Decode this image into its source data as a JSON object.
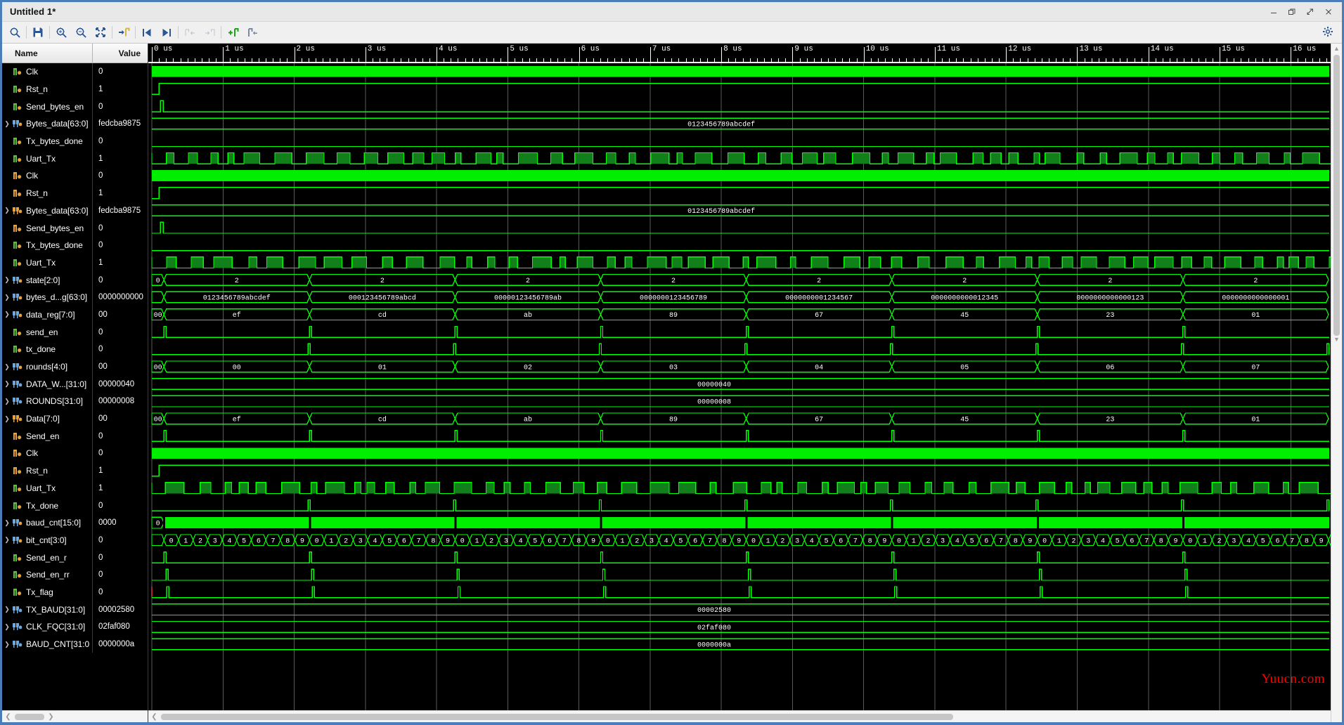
{
  "window": {
    "title": "Untitled 1*",
    "controls": [
      "minimize",
      "restore",
      "maximize",
      "close"
    ]
  },
  "toolbar": {
    "buttons": [
      {
        "name": "search-icon",
        "label": "Search",
        "enabled": true
      },
      {
        "name": "save-icon",
        "label": "Save",
        "enabled": true
      },
      {
        "name": "zoom-in-icon",
        "label": "Zoom In",
        "enabled": true
      },
      {
        "name": "zoom-out-icon",
        "label": "Zoom Out",
        "enabled": true
      },
      {
        "name": "zoom-fit-icon",
        "label": "Zoom Fit",
        "enabled": true
      },
      {
        "name": "goto-marker-icon",
        "label": "Go To Marker",
        "enabled": true
      },
      {
        "name": "previous-transition-icon",
        "label": "Previous Transition",
        "enabled": true
      },
      {
        "name": "next-transition-icon",
        "label": "Next Transition",
        "enabled": true
      },
      {
        "name": "previous-marker-icon",
        "label": "Previous Marker",
        "enabled": false
      },
      {
        "name": "next-marker-icon",
        "label": "Next Marker",
        "enabled": false
      },
      {
        "name": "add-marker-icon",
        "label": "Add Marker",
        "enabled": true
      },
      {
        "name": "delete-marker-icon",
        "label": "Delete Marker",
        "enabled": true
      }
    ],
    "settings_label": "Settings"
  },
  "columns": {
    "name": "Name",
    "value": "Value"
  },
  "signals": [
    {
      "name": "Clk",
      "value": "0",
      "icon": "clock-green",
      "expandable": false
    },
    {
      "name": "Rst_n",
      "value": "1",
      "icon": "wire-green",
      "expandable": false
    },
    {
      "name": "Send_bytes_en",
      "value": "0",
      "icon": "wire-green",
      "expandable": false
    },
    {
      "name": "Bytes_data[63:0]",
      "value": "fedcba9875",
      "icon": "bus-orange",
      "expandable": true
    },
    {
      "name": "Tx_bytes_done",
      "value": "0",
      "icon": "wire-green",
      "expandable": false
    },
    {
      "name": "Uart_Tx",
      "value": "1",
      "icon": "wire-green",
      "expandable": false
    },
    {
      "name": "Clk",
      "value": "0",
      "icon": "clock-orange",
      "expandable": false
    },
    {
      "name": "Rst_n",
      "value": "1",
      "icon": "wire-orange",
      "expandable": false
    },
    {
      "name": "Bytes_data[63:0]",
      "value": "fedcba9875",
      "icon": "bus-orange2",
      "expandable": true
    },
    {
      "name": "Send_bytes_en",
      "value": "0",
      "icon": "wire-orange",
      "expandable": false
    },
    {
      "name": "Tx_bytes_done",
      "value": "0",
      "icon": "wire-green2",
      "expandable": false
    },
    {
      "name": "Uart_Tx",
      "value": "1",
      "icon": "wire-green2",
      "expandable": false
    },
    {
      "name": "state[2:0]",
      "value": "0",
      "icon": "bus-orange",
      "expandable": true
    },
    {
      "name": "bytes_d...g[63:0]",
      "value": "0000000000",
      "icon": "bus-orange",
      "expandable": true
    },
    {
      "name": "data_reg[7:0]",
      "value": "00",
      "icon": "bus-orange",
      "expandable": true
    },
    {
      "name": "send_en",
      "value": "0",
      "icon": "wire-green",
      "expandable": false
    },
    {
      "name": "tx_done",
      "value": "0",
      "icon": "wire-green",
      "expandable": false
    },
    {
      "name": "rounds[4:0]",
      "value": "00",
      "icon": "bus-orange",
      "expandable": true
    },
    {
      "name": "DATA_W...[31:0]",
      "value": "00000040",
      "icon": "bus-blue",
      "expandable": true
    },
    {
      "name": "ROUNDS[31:0]",
      "value": "00000008",
      "icon": "bus-blue",
      "expandable": true
    },
    {
      "name": "Data[7:0]",
      "value": "00",
      "icon": "bus-orange2",
      "expandable": true
    },
    {
      "name": "Send_en",
      "value": "0",
      "icon": "wire-orange",
      "expandable": false
    },
    {
      "name": "Clk",
      "value": "0",
      "icon": "clock-orange",
      "expandable": false
    },
    {
      "name": "Rst_n",
      "value": "1",
      "icon": "wire-orange",
      "expandable": false
    },
    {
      "name": "Uart_Tx",
      "value": "1",
      "icon": "wire-green2",
      "expandable": false
    },
    {
      "name": "Tx_done",
      "value": "0",
      "icon": "wire-green2",
      "expandable": false
    },
    {
      "name": "baud_cnt[15:0]",
      "value": "0000",
      "icon": "bus-orange",
      "expandable": true
    },
    {
      "name": "bit_cnt[3:0]",
      "value": "0",
      "icon": "bus-orange",
      "expandable": true
    },
    {
      "name": "Send_en_r",
      "value": "0",
      "icon": "wire-green",
      "expandable": false
    },
    {
      "name": "Send_en_rr",
      "value": "0",
      "icon": "wire-green",
      "expandable": false
    },
    {
      "name": "Tx_flag",
      "value": "0",
      "icon": "wire-green",
      "expandable": false
    },
    {
      "name": "TX_BAUD[31:0]",
      "value": "00002580",
      "icon": "bus-blue",
      "expandable": true
    },
    {
      "name": "CLK_FQC[31:0]",
      "value": "02faf080",
      "icon": "bus-blue",
      "expandable": true
    },
    {
      "name": "BAUD_CNT[31:0",
      "value": "0000000a",
      "icon": "bus-blue",
      "expandable": true
    }
  ],
  "timeline": {
    "unit": "us",
    "labels": [
      "0 us",
      "1 us",
      "2 us",
      "3 us",
      "4 us",
      "5 us",
      "6 us",
      "7 us",
      "8 us",
      "9 us",
      "10 us",
      "11 us",
      "12 us",
      "13 us",
      "14 us",
      "15 us",
      "16 us"
    ],
    "start": 0,
    "end": 16.55,
    "minor_per_major": 10
  },
  "waveforms": {
    "constant_labels": [
      {
        "row": 3,
        "text": "0123456789abcdef",
        "x_us": 8.0
      },
      {
        "row": 8,
        "text": "0123456789abcdef",
        "x_us": 8.0
      },
      {
        "row": 18,
        "text": "00000040",
        "x_us": 7.9
      },
      {
        "row": 19,
        "text": "00000008",
        "x_us": 7.9
      },
      {
        "row": 31,
        "text": "00002580",
        "x_us": 7.9
      },
      {
        "row": 32,
        "text": "02faf080",
        "x_us": 7.9
      },
      {
        "row": 33,
        "text": "0000000a",
        "x_us": 7.9
      }
    ],
    "state_row": {
      "row": 12,
      "initial": "0",
      "segments": [
        "2",
        "2",
        "2",
        "2",
        "2",
        "2",
        "2",
        "2"
      ]
    },
    "bytes_shift_row": {
      "row": 13,
      "segments": [
        "0123456789abcdef",
        "000123456789abcd",
        "00000123456789ab",
        "0000000123456789",
        "0000000001234567",
        "0000000000012345",
        "0000000000000123",
        "0000000000000001"
      ]
    },
    "data_reg_row": {
      "row": 14,
      "initial": "00",
      "segments": [
        "ef",
        "cd",
        "ab",
        "89",
        "67",
        "45",
        "23",
        "01"
      ]
    },
    "rounds_row": {
      "row": 17,
      "initial": "00",
      "segments": [
        "00",
        "01",
        "02",
        "03",
        "04",
        "05",
        "06",
        "07"
      ]
    },
    "data_row": {
      "row": 20,
      "initial": "00",
      "segments": [
        "ef",
        "cd",
        "ab",
        "89",
        "67",
        "45",
        "23",
        "01"
      ]
    },
    "baud_cnt_row": {
      "row": 26,
      "initial": "0"
    },
    "bit_cnt_row": {
      "row": 27,
      "digits": [
        "0",
        "1",
        "2",
        "3",
        "4",
        "5",
        "6",
        "7",
        "8",
        "9"
      ]
    }
  },
  "colors": {
    "wave_green": "#00ff00",
    "wave_dark_green": "#1a7a1a",
    "background": "#000000",
    "grid": "#5a5a5a",
    "accent": "#4a7ebb",
    "watermark": "#ff0000",
    "icon_orange": "#e8a33d",
    "icon_green": "#5fbf3f",
    "icon_blue": "#6fa8dc"
  },
  "watermark": {
    "text": "Yuucn.com"
  },
  "scrollbars": {
    "left_h_position": "left",
    "wave_h_position": "left",
    "vertical_position": "top"
  }
}
